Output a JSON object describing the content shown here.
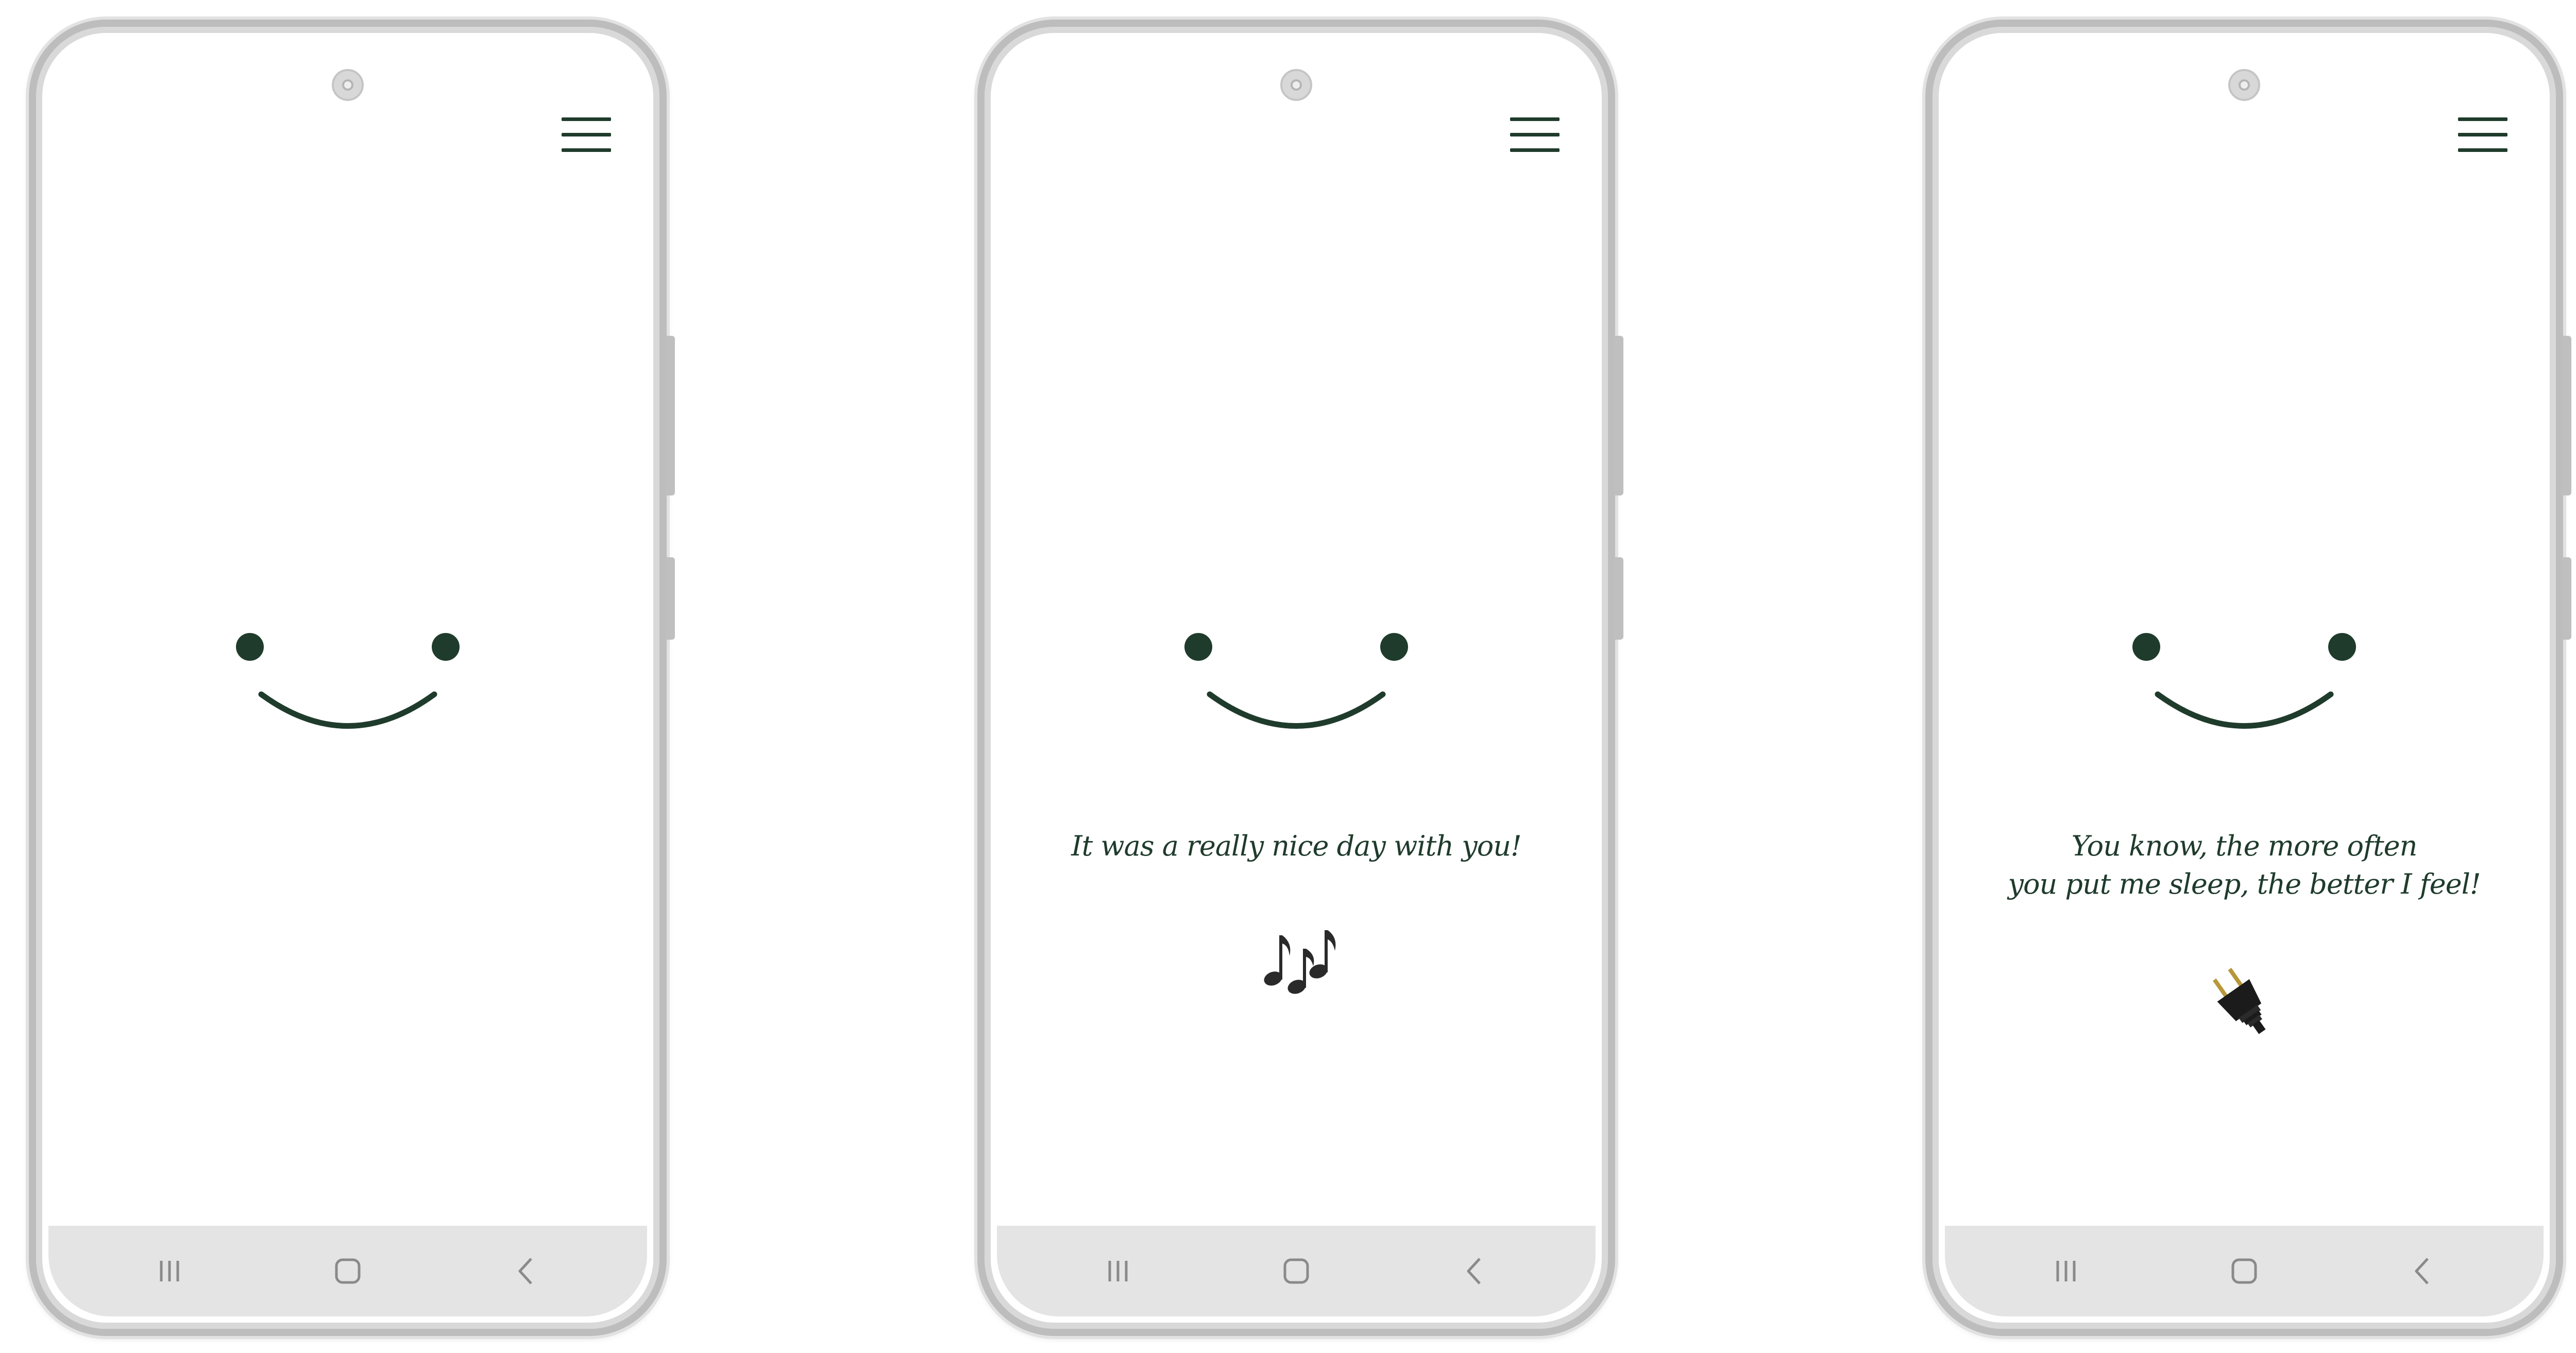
{
  "colors": {
    "accent": "#1f3b2c",
    "navbar": "#e4e4e4",
    "frame": "#bdbdbd"
  },
  "phones": [
    {
      "message_lines": [],
      "emoji": ""
    },
    {
      "message_lines": [
        "It was a really nice day with you!"
      ],
      "emoji": "musical-notes-icon"
    },
    {
      "message_lines": [
        "You know, the more often",
        "you put me sleep, the better I feel!"
      ],
      "emoji": "electric-plug-icon"
    }
  ],
  "icons": {
    "menu": "hamburger-menu-icon",
    "recent": "recent-apps-icon",
    "home": "home-icon",
    "back": "back-icon"
  }
}
